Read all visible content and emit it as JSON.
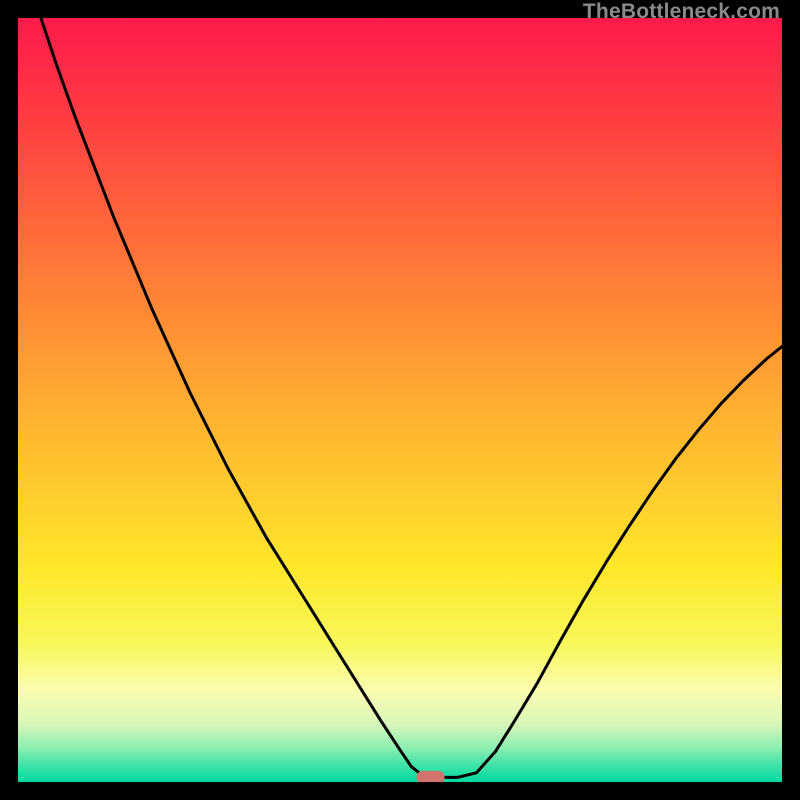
{
  "watermark": "TheBottleneck.com",
  "gradient_stops": [
    {
      "offset": 0.0,
      "color": "#ff1a4b"
    },
    {
      "offset": 0.12,
      "color": "#ff3a43"
    },
    {
      "offset": 0.28,
      "color": "#ff6a3a"
    },
    {
      "offset": 0.44,
      "color": "#ff9a33"
    },
    {
      "offset": 0.58,
      "color": "#ffc22e"
    },
    {
      "offset": 0.72,
      "color": "#ffe72b"
    },
    {
      "offset": 0.82,
      "color": "#f7f85a"
    },
    {
      "offset": 0.88,
      "color": "#fbfcb0"
    },
    {
      "offset": 0.925,
      "color": "#d7f6b8"
    },
    {
      "offset": 0.955,
      "color": "#8ceeb1"
    },
    {
      "offset": 0.978,
      "color": "#3fe3aa"
    },
    {
      "offset": 1.0,
      "color": "#00d99f"
    }
  ],
  "chart_data": {
    "type": "line",
    "title": "",
    "xlabel": "",
    "ylabel": "",
    "xlim": [
      0,
      100
    ],
    "ylim": [
      0,
      100
    ],
    "x": [
      3,
      5,
      7.5,
      10,
      12.5,
      15,
      17.5,
      20,
      22.5,
      25,
      27.5,
      30,
      32.5,
      35,
      37.5,
      40,
      42.5,
      45,
      47.5,
      50,
      51.5,
      53,
      55,
      57.5,
      60,
      62.5,
      65,
      68,
      71,
      74,
      77,
      80,
      83,
      86,
      89,
      92,
      95,
      98,
      100
    ],
    "y": [
      100,
      94,
      87,
      80.5,
      74,
      68,
      62,
      56.5,
      51,
      46,
      41,
      36.5,
      32,
      28,
      24,
      20,
      16,
      12,
      8,
      4.2,
      2,
      0.8,
      0.6,
      0.6,
      1.2,
      4,
      8,
      13,
      18.5,
      23.8,
      28.8,
      33.5,
      38,
      42.2,
      46,
      49.5,
      52.6,
      55.4,
      57
    ],
    "min_point": {
      "x": 54,
      "y": 0.6
    }
  }
}
